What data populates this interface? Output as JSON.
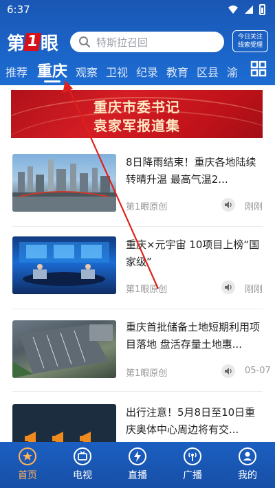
{
  "status": {
    "time": "6:37"
  },
  "header": {
    "logo": {
      "left": "第",
      "mark": "1",
      "right": "眼"
    },
    "search_placeholder": "特斯拉召回",
    "subscribe_line1": "今日关注",
    "subscribe_line2": "线索受理",
    "tabs": [
      "推荐",
      "重庆",
      "观察",
      "卫视",
      "纪录",
      "教育",
      "区县",
      "渝"
    ],
    "active_tab": "重庆"
  },
  "banner": {
    "line1": "重庆市委书记",
    "line2": "袁家军报道集"
  },
  "news": [
    {
      "title": "8日降雨结束！重庆各地陆续转晴升温 最高气温2...",
      "source": "第1眼原创",
      "time": "刚刚"
    },
    {
      "title": "重庆×元宇宙 10项目上榜“国家级”",
      "source": "第1眼原创",
      "time": "刚刚"
    },
    {
      "title": "重庆首批储备土地短期利用项目落地 盘活存量土地惠...",
      "source": "第1眼原创",
      "time": "05-07"
    },
    {
      "title": "出行注意！5月8日至10日重庆奥体中心周边将有交...",
      "source": "",
      "time": ""
    }
  ],
  "bottom_nav": [
    {
      "label": "首页",
      "icon": "star-icon",
      "active": true
    },
    {
      "label": "电视",
      "icon": "tv-icon",
      "active": false
    },
    {
      "label": "直播",
      "icon": "lightning-icon",
      "active": false
    },
    {
      "label": "广播",
      "icon": "broadcast-icon",
      "active": false
    },
    {
      "label": "我的",
      "icon": "person-icon",
      "active": false
    }
  ],
  "colors": {
    "header_blue": "#1b63c6",
    "banner_red": "#d51d24",
    "active_nav": "#ffb25a"
  }
}
